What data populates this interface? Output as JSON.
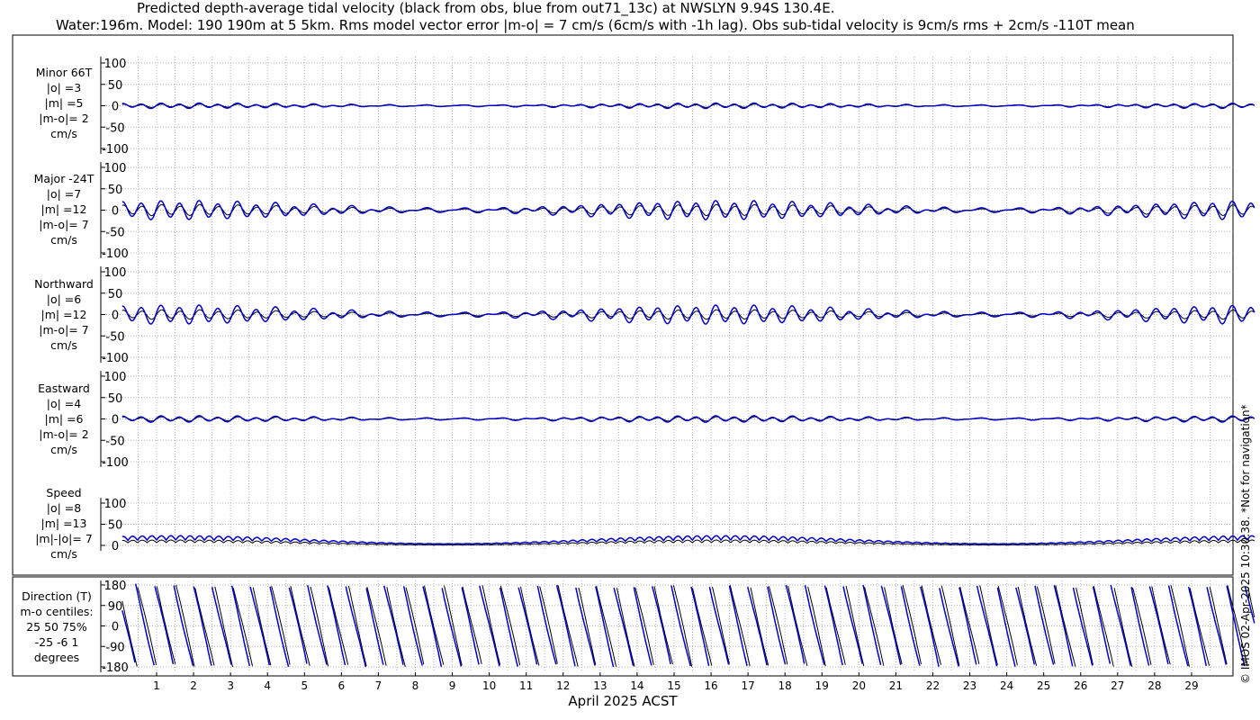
{
  "title": {
    "line1": "Predicted depth-average tidal velocity (black from obs, blue from out71_13c) at NWSLYN 9.94S 130.4E.",
    "line2": "Water:196m. Model: 190 190m at 5 5km. Rms model vector error |m-o| = 7 cm/s (6cm/s with -1h lag). Obs sub-tidal velocity is 9cm/s rms + 2cm/s -110T mean"
  },
  "watermark": "© IMOS 02-Apr-2025 10:30:38. *Not for navigation*",
  "xaxis": {
    "label": "April 2025 ACST",
    "ticks": [
      "1",
      "2",
      "3",
      "4",
      "5",
      "6",
      "7",
      "8",
      "9",
      "10",
      "11",
      "12",
      "13",
      "14",
      "15",
      "16",
      "17",
      "18",
      "19",
      "20",
      "21",
      "22",
      "23",
      "24",
      "25",
      "26",
      "27",
      "28",
      "29"
    ]
  },
  "colors": {
    "obs": "#000000",
    "model": "#0000cc",
    "grid": "#b4b4b4"
  },
  "chart_data": [
    {
      "type": "line",
      "panel": "minor",
      "label": [
        "Minor 66T",
        "|o| =3",
        "|m| =5",
        "|m-o|= 2",
        "cm/s"
      ],
      "ylim": [
        -100,
        100
      ],
      "yticks": [
        "100",
        "50",
        "0",
        "-50",
        "-100"
      ],
      "series": [
        {
          "role": "obs",
          "amplitude": 3
        },
        {
          "role": "model",
          "amplitude": 5
        }
      ]
    },
    {
      "type": "line",
      "panel": "major",
      "label": [
        "Major -24T",
        "|o| =7",
        "|m| =12",
        "|m-o|= 7",
        "cm/s"
      ],
      "ylim": [
        -100,
        100
      ],
      "yticks": [
        "100",
        "50",
        "0",
        "-50",
        "-100"
      ],
      "series": [
        {
          "role": "obs",
          "amplitude": 7
        },
        {
          "role": "model",
          "amplitude": 12
        }
      ]
    },
    {
      "type": "line",
      "panel": "northward",
      "label": [
        "Northward",
        "|o| =6",
        "|m| =12",
        "|m-o|= 7",
        "cm/s"
      ],
      "ylim": [
        -100,
        100
      ],
      "yticks": [
        "100",
        "50",
        "0",
        "-50",
        "-100"
      ],
      "series": [
        {
          "role": "obs",
          "amplitude": 6
        },
        {
          "role": "model",
          "amplitude": 12
        }
      ]
    },
    {
      "type": "line",
      "panel": "eastward",
      "label": [
        "Eastward",
        "|o| =4",
        "|m| =6",
        "|m-o|= 2",
        "cm/s"
      ],
      "ylim": [
        -100,
        100
      ],
      "yticks": [
        "100",
        "50",
        "0",
        "-50",
        "-100"
      ],
      "series": [
        {
          "role": "obs",
          "amplitude": 4
        },
        {
          "role": "model",
          "amplitude": 6
        }
      ]
    },
    {
      "type": "line",
      "panel": "speed",
      "label": [
        "Speed",
        "|o| =8",
        "|m| =13",
        "|m|-|o|= 7",
        "cm/s"
      ],
      "ylim": [
        0,
        100
      ],
      "yticks": [
        "100",
        "50",
        "0"
      ],
      "series": [
        {
          "role": "obs",
          "amplitude": 8
        },
        {
          "role": "model",
          "amplitude": 13
        }
      ]
    },
    {
      "type": "line",
      "panel": "direction",
      "label": [
        "Direction (T)",
        "m-o centiles:",
        "25  50  75%",
        "-25  -6   1",
        "degrees"
      ],
      "ylim": [
        -180,
        180
      ],
      "yticks": [
        "180",
        "90",
        "0",
        "-90",
        "-180"
      ],
      "series": [
        {
          "role": "obs"
        },
        {
          "role": "model"
        }
      ]
    }
  ]
}
